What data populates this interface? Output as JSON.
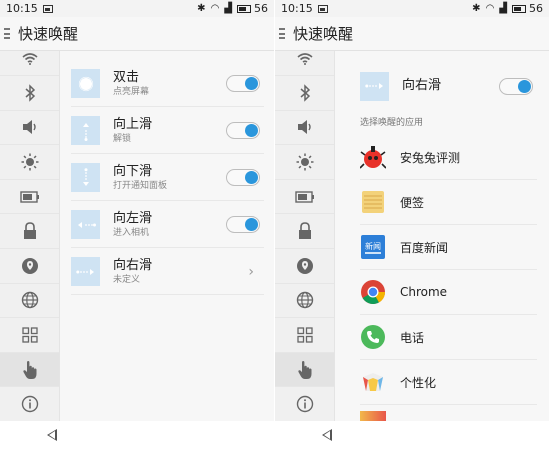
{
  "statusbar": {
    "time": "10:15",
    "battery": "56"
  },
  "header": {
    "title": "快速唤醒"
  },
  "left": {
    "gestures": [
      {
        "title": "双击",
        "subtitle": "点亮屏幕",
        "control": "toggle"
      },
      {
        "title": "向上滑",
        "subtitle": "解锁",
        "control": "toggle"
      },
      {
        "title": "向下滑",
        "subtitle": "打开通知面板",
        "control": "toggle"
      },
      {
        "title": "向左滑",
        "subtitle": "进入相机",
        "control": "toggle"
      },
      {
        "title": "向右滑",
        "subtitle": "未定义",
        "control": "chevron"
      }
    ],
    "chevron": "›"
  },
  "right": {
    "gesture": {
      "title": "向右滑"
    },
    "section_label": "选择唤醒的应用",
    "apps": [
      {
        "label": "安兔兔评测",
        "icon": "antutu-icon"
      },
      {
        "label": "便签",
        "icon": "notes-icon"
      },
      {
        "label": "百度新闻",
        "icon": "baidu-news-icon"
      },
      {
        "label": "Chrome",
        "icon": "chrome-icon"
      },
      {
        "label": "电话",
        "icon": "phone-icon"
      },
      {
        "label": "个性化",
        "icon": "personalize-icon"
      }
    ]
  },
  "sidebar_icons": [
    "wifi-icon",
    "bluetooth-icon",
    "volume-icon",
    "brightness-icon",
    "battery-icon",
    "lock-icon",
    "location-icon",
    "globe-icon",
    "apps-grid-icon",
    "gesture-hand-icon",
    "info-icon"
  ],
  "colors": {
    "accent": "#2a96dc",
    "thumb": "#cfe3f3"
  }
}
